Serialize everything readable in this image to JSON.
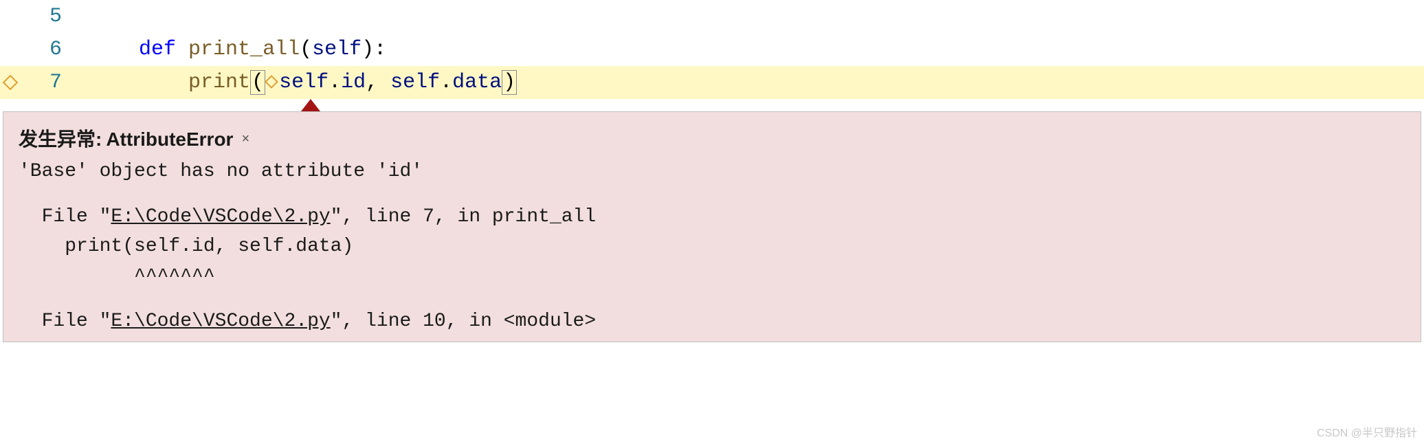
{
  "editor": {
    "lines": [
      {
        "num": "5",
        "gutter_icon": null
      },
      {
        "num": "6",
        "gutter_icon": null
      },
      {
        "num": "7",
        "gutter_icon": "breakpoint"
      }
    ],
    "line6": {
      "indent": "    ",
      "kw": "def",
      "sp1": " ",
      "fn": "print_all",
      "open": "(",
      "param": "self",
      "close": ")",
      "colon": ":"
    },
    "line7": {
      "indent": "        ",
      "call": "print",
      "open": "(",
      "arg1a": "self",
      "dot1": ".",
      "arg1b": "id",
      "comma": ", ",
      "arg2a": "self",
      "dot2": ".",
      "arg2b": "data",
      "close": ")"
    }
  },
  "exception": {
    "title_prefix": "发生异常: ",
    "title_error": "AttributeError",
    "close_label": "×",
    "message": "'Base' object has no attribute 'id'",
    "trace1_pre": "  File \"",
    "trace1_file": "E:\\Code\\VSCode\\2.py",
    "trace1_post": "\", line 7, in print_all",
    "trace1_code": "    print(self.id, self.data)",
    "trace1_caret": "          ^^^^^^^",
    "trace2_pre": "  File \"",
    "trace2_file": "E:\\Code\\VSCode\\2.py",
    "trace2_post": "\", line 10, in <module>"
  },
  "watermark": "CSDN @半只野指针"
}
